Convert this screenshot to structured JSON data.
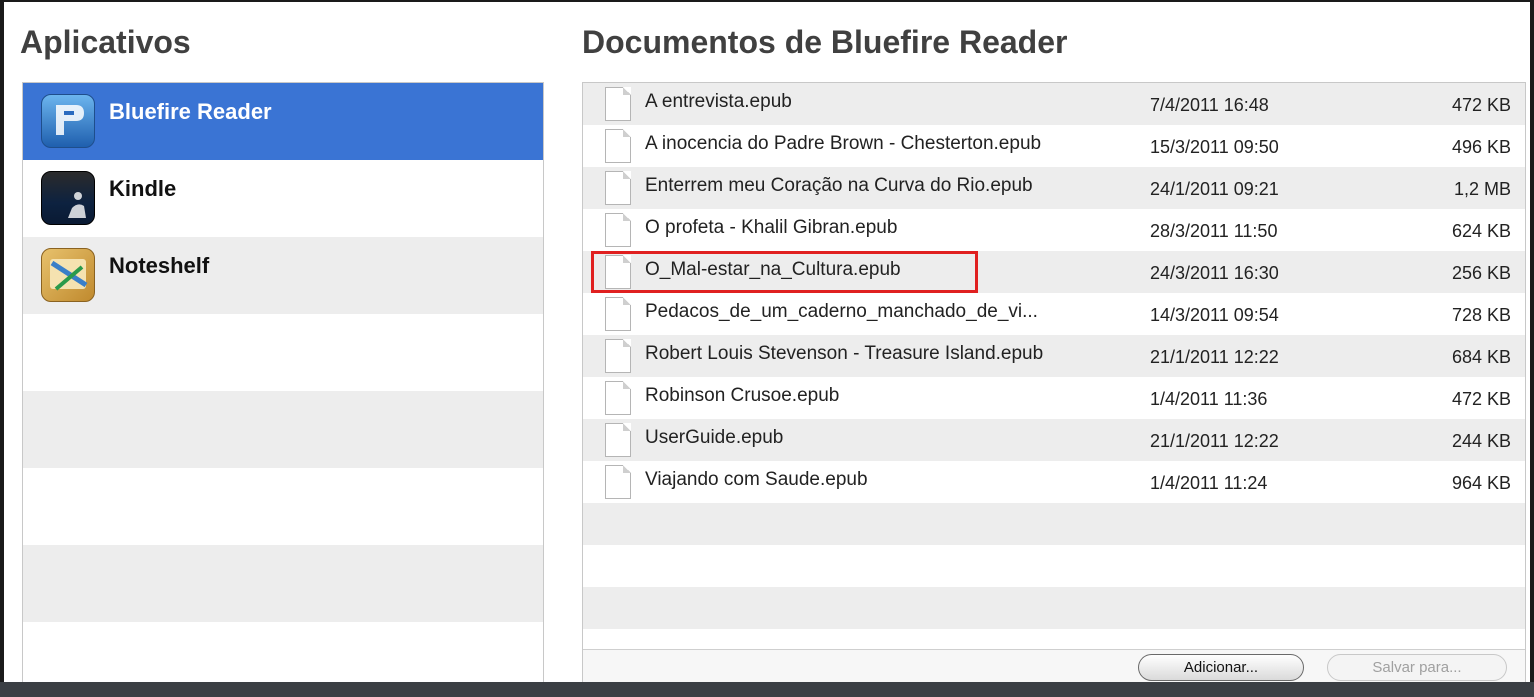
{
  "apps": {
    "title": "Aplicativos",
    "items": [
      {
        "label": "Bluefire Reader",
        "selected": true,
        "icon": "bluefire-reader-icon"
      },
      {
        "label": "Kindle",
        "selected": false,
        "icon": "kindle-icon"
      },
      {
        "label": "Noteshelf",
        "selected": false,
        "icon": "noteshelf-icon"
      }
    ]
  },
  "documents": {
    "title": "Documentos de Bluefire Reader",
    "files": [
      {
        "name": "A entrevista.epub",
        "date": "7/4/2011 16:48",
        "size": "472 KB"
      },
      {
        "name": "A inocencia do Padre Brown - Chesterton.epub",
        "date": "15/3/2011 09:50",
        "size": "496 KB"
      },
      {
        "name": "Enterrem meu Coração na Curva do Rio.epub",
        "date": "24/1/2011 09:21",
        "size": "1,2 MB"
      },
      {
        "name": "O profeta - Khalil Gibran.epub",
        "date": "28/3/2011 11:50",
        "size": "624 KB"
      },
      {
        "name": "O_Mal-estar_na_Cultura.epub",
        "date": "24/3/2011 16:30",
        "size": "256 KB",
        "highlighted": true
      },
      {
        "name": "Pedacos_de_um_caderno_manchado_de_vi...",
        "date": "14/3/2011 09:54",
        "size": "728 KB"
      },
      {
        "name": "Robert Louis Stevenson - Treasure Island.epub",
        "date": "21/1/2011 12:22",
        "size": "684 KB"
      },
      {
        "name": "Robinson Crusoe.epub",
        "date": "1/4/2011 11:36",
        "size": "472 KB"
      },
      {
        "name": "UserGuide.epub",
        "date": "21/1/2011 12:22",
        "size": "244 KB"
      },
      {
        "name": "Viajando com Saude.epub",
        "date": "1/4/2011 11:24",
        "size": "964 KB"
      }
    ],
    "add_button": "Adicionar...",
    "save_button": "Salvar para..."
  },
  "colors": {
    "selection": "#3a74d4",
    "highlight_border": "#e02020",
    "stripe": "#ededed"
  }
}
